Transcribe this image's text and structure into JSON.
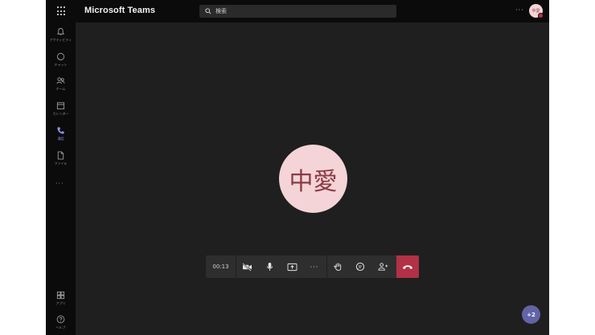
{
  "header": {
    "app_title": "Microsoft Teams",
    "search_placeholder": "検索",
    "more_label": "···",
    "user_initials": "中愛"
  },
  "rail": {
    "items": [
      {
        "label": "アクティビティ",
        "icon": "bell-icon"
      },
      {
        "label": "チャット",
        "icon": "chat-icon"
      },
      {
        "label": "チーム",
        "icon": "teams-icon"
      },
      {
        "label": "カレンダー",
        "icon": "calendar-icon"
      },
      {
        "label": "通話",
        "icon": "phone-icon"
      },
      {
        "label": "ファイル",
        "icon": "file-icon"
      }
    ],
    "more_label": "···",
    "bottom_items": [
      {
        "label": "アプリ",
        "icon": "apps-icon"
      },
      {
        "label": "ヘルプ",
        "icon": "help-icon"
      }
    ]
  },
  "call": {
    "participant_initials": "中愛",
    "timer": "00:13",
    "more_label": "···",
    "participants_overflow": "+2"
  },
  "colors": {
    "accent": "#6264a7",
    "hangup": "#b23146",
    "avatar_bg": "#f4d4d6",
    "avatar_text": "#8a3b46",
    "stage_bg": "#1f1f1f"
  }
}
